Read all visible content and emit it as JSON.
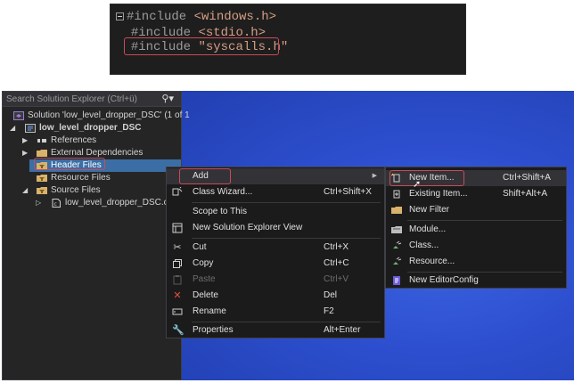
{
  "code": {
    "lines": [
      {
        "keyword": "#include",
        "path": "<windows.h>"
      },
      {
        "keyword": "#include",
        "path": "<stdio.h>"
      },
      {
        "keyword": "#include",
        "path": "\"syscalls.h\""
      }
    ]
  },
  "explorer": {
    "search_placeholder": "Search Solution Explorer (Ctrl+ü)",
    "solution": "Solution 'low_level_dropper_DSC' (1 of 1",
    "project": "low_level_dropper_DSC",
    "items": [
      {
        "label": "References"
      },
      {
        "label": "External Dependencies"
      },
      {
        "label": "Header Files"
      },
      {
        "label": "Resource Files"
      },
      {
        "label": "Source Files"
      },
      {
        "label": "low_level_dropper_DSC.c"
      }
    ]
  },
  "context_menu": {
    "add": "Add",
    "class_wizard": {
      "label": "Class Wizard...",
      "shortcut": "Ctrl+Shift+X"
    },
    "scope": "Scope to This",
    "new_view": "New Solution Explorer View",
    "cut": {
      "label": "Cut",
      "shortcut": "Ctrl+X"
    },
    "copy": {
      "label": "Copy",
      "shortcut": "Ctrl+C"
    },
    "paste": {
      "label": "Paste",
      "shortcut": "Ctrl+V"
    },
    "delete": {
      "label": "Delete",
      "shortcut": "Del"
    },
    "rename": {
      "label": "Rename",
      "shortcut": "F2"
    },
    "properties": {
      "label": "Properties",
      "shortcut": "Alt+Enter"
    }
  },
  "add_submenu": {
    "new_item": {
      "label": "New Item...",
      "shortcut": "Ctrl+Shift+A"
    },
    "existing_item": {
      "label": "Existing Item...",
      "shortcut": "Shift+Alt+A"
    },
    "new_filter": "New Filter",
    "module": "Module...",
    "class": "Class...",
    "resource": "Resource...",
    "editor_config": "New EditorConfig"
  },
  "colors": {
    "highlight_border": "#c84b5a",
    "selection": "#3b6ea5",
    "desktop_blue": "#2d4fcf",
    "menu_bg": "#1b1b1c"
  }
}
